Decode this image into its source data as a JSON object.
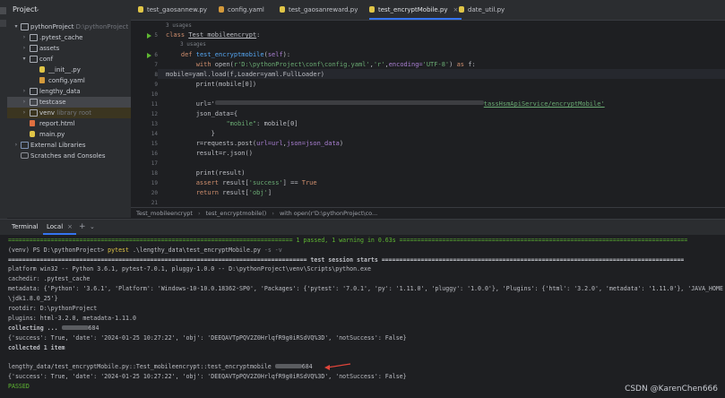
{
  "project_panel": {
    "title": "Project",
    "tree": [
      {
        "label": "pythonProject",
        "hint": "D:\\pythonProject",
        "icon": "folder"
      },
      {
        "label": ".pytest_cache",
        "icon": "folder"
      },
      {
        "label": "assets",
        "icon": "folder"
      },
      {
        "label": "conf",
        "icon": "folder"
      },
      {
        "label": "__init__.py",
        "icon": "py"
      },
      {
        "label": "config.yaml",
        "icon": "yaml"
      },
      {
        "label": "lengthy_data",
        "icon": "folder"
      },
      {
        "label": "testcase",
        "icon": "folder"
      },
      {
        "label": "venv",
        "hint": "library root",
        "icon": "folder"
      },
      {
        "label": "report.html",
        "icon": "html"
      },
      {
        "label": "main.py",
        "icon": "py"
      },
      {
        "label": "External Libraries",
        "icon": "lib"
      },
      {
        "label": "Scratches and Consoles",
        "icon": "console"
      }
    ]
  },
  "tabs": [
    {
      "label": "test_gaosannew.py"
    },
    {
      "label": "config.yaml"
    },
    {
      "label": "test_gaosanreward.py"
    },
    {
      "label": "test_encryptMobile.py"
    },
    {
      "label": "date_util.py"
    }
  ],
  "editor": {
    "line_numbers": [
      "5",
      "6",
      "7",
      "8",
      "9",
      "10",
      "11",
      "12",
      "13",
      "14",
      "15",
      "16",
      "17",
      "18",
      "19",
      "20",
      "21"
    ],
    "usages": "3 usages",
    "lines": {
      "l5_class": "class",
      "l5_name": "Test_mobileencrypt",
      "l6_def": "def",
      "l6_name": "test_encryptmobile",
      "l6_self": "self",
      "l7_with": "with",
      "l7_open": "open(",
      "l7_path": "r'D:\\pythonProject\\conf\\config.yaml'",
      "l7_mode": "'r'",
      "l7_enc_kw": "encoding=",
      "l7_enc": "'UTF-8'",
      "l7_as": "as",
      "l7_f": "f:",
      "l8": "mobile=yaml.load(f,Loader=yaml.FullLoader)",
      "l9": "print(mobile[0])",
      "l11_a": "url='",
      "l11_b": "tassHsmApiService/encryptMobile'",
      "l12": "json_data={",
      "l13_key": "\"mobile\"",
      "l13_val": ": mobile[0]",
      "l14": "}",
      "l15_a": "r=requests.post(",
      "l15_url": "url=url",
      "l15_json": "json=json_data",
      "l16": "result=r.json()",
      "l18": "print(result)",
      "l19_assert": "assert",
      "l19_rest": " result[",
      "l19_key": "'success'",
      "l19_end": "] == ",
      "l19_true": "True",
      "l20_return": "return",
      "l20_rest": " result[",
      "l20_key": "'obj'",
      "l20_end": "]"
    }
  },
  "breadcrumb": [
    "Test_mobileencrypt",
    "test_encryptmobile()",
    "with open(r'D:\\pythonProject\\co..."
  ],
  "terminal": {
    "title": "Terminal",
    "tab": "Local",
    "lines": {
      "t1": "(venv) PS D:\\pythonProject> ",
      "t1_cmd": "pytest",
      "t1_arg": " .\\lengthy_data\\test_encryptMobile.py",
      "t1_flag": " -s -v",
      "t2": "================================================================================ 1 passed, 1 warning in 0.63s =================================================================================",
      "t3": "==================================================================================== test session starts =====================================================================================",
      "t4": "platform win32 -- Python 3.6.1, pytest-7.0.1, pluggy-1.0.0 -- D:\\pythonProject\\venv\\Scripts\\python.exe",
      "t5": "cachedir: .pytest_cache",
      "t6": "metadata: {'Python': '3.6.1', 'Platform': 'Windows-10-10.0.18362-SP0', 'Packages': {'pytest': '7.0.1', 'py': '1.11.0', 'pluggy': '1.0.0'}, 'Plugins': {'html': '3.2.0', 'metadata': '1.11.0'}, 'JAVA_HOME",
      "t7": "\\jdk1.8.0_25'}",
      "t8": "rootdir: D:\\pythonProject",
      "t9": "plugins: html-3.2.0, metadata-1.11.0",
      "t10a": "collecting ... ",
      "t10b": "684",
      "t11": "{'success': True, 'date': '2024-01-25 10:27:22', 'obj': 'DEEQAVTpPQV2Z0HrlqfR9g0iRSdVQ%3D', 'notSuccess': False}",
      "t12": "collected 1 item",
      "t13a": "lengthy_data/test_encryptMobile.py::Test_mobileencrypt::test_encryptmobile ",
      "t13b": "684",
      "t14": "{'success': True, 'date': '2024-01-25 10:27:22', 'obj': 'DEEQAVTpPQV2Z0HrlqfR9g0iRSdVQ%3D', 'notSuccess': False}",
      "t15": "PASSED"
    }
  },
  "watermark": "CSDN @KarenChen666",
  "colors": {
    "accent": "#3574f0",
    "keyword": "#cf8e6d",
    "function": "#56a8f5",
    "string": "#6aab73",
    "passed": "#5fb832",
    "annotation_arrow": "#e0453a"
  }
}
